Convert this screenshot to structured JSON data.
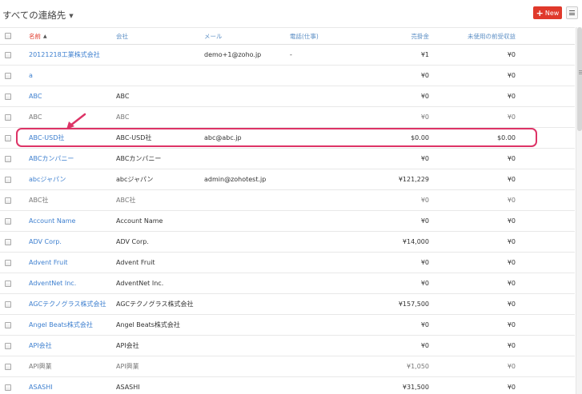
{
  "header": {
    "view_title": "すべての連絡先",
    "new_button_label": "New"
  },
  "columns": {
    "name": "名前",
    "company": "会社",
    "email": "メール",
    "phone": "電話(仕事)",
    "sales": "売掛金",
    "unused": "未使用の前受収益"
  },
  "rows": [
    {
      "name": "20121218工業株式会社",
      "company": "",
      "email": "demo+1@zoho.jp",
      "phone": "-",
      "sales": "¥1",
      "unused": "¥0"
    },
    {
      "name": "a",
      "company": "",
      "email": "",
      "phone": "",
      "sales": "¥0",
      "unused": "¥0"
    },
    {
      "name": "ABC",
      "company": "ABC",
      "email": "",
      "phone": "",
      "sales": "¥0",
      "unused": "¥0"
    },
    {
      "name": "ABC",
      "company": "ABC",
      "email": "",
      "phone": "",
      "sales": "¥0",
      "unused": "¥0"
    },
    {
      "name": "ABC-USD社",
      "company": "ABC-USD社",
      "email": "abc@abc.jp",
      "phone": "",
      "sales": "$0.00",
      "unused": "$0.00"
    },
    {
      "name": "ABCカンパニー",
      "company": "ABCカンパニー",
      "email": "",
      "phone": "",
      "sales": "¥0",
      "unused": "¥0"
    },
    {
      "name": "abcジャパン",
      "company": "abcジャパン",
      "email": "admin@zohotest.jp",
      "phone": "",
      "sales": "¥121,229",
      "unused": "¥0"
    },
    {
      "name": "ABC社",
      "company": "ABC社",
      "email": "",
      "phone": "",
      "sales": "¥0",
      "unused": "¥0"
    },
    {
      "name": "Account Name",
      "company": "Account Name",
      "email": "",
      "phone": "",
      "sales": "¥0",
      "unused": "¥0"
    },
    {
      "name": "ADV Corp.",
      "company": "ADV Corp.",
      "email": "",
      "phone": "",
      "sales": "¥14,000",
      "unused": "¥0"
    },
    {
      "name": "Advent Fruit",
      "company": "Advent Fruit",
      "email": "",
      "phone": "",
      "sales": "¥0",
      "unused": "¥0"
    },
    {
      "name": "AdventNet Inc.",
      "company": "AdventNet Inc.",
      "email": "",
      "phone": "",
      "sales": "¥0",
      "unused": "¥0"
    },
    {
      "name": "AGCテクノグラス株式会社",
      "company": "AGCテクノグラス株式会社",
      "email": "",
      "phone": "",
      "sales": "¥157,500",
      "unused": "¥0"
    },
    {
      "name": "Angel Beats株式会社",
      "company": "Angel Beats株式会社",
      "email": "",
      "phone": "",
      "sales": "¥0",
      "unused": "¥0"
    },
    {
      "name": "API会社",
      "company": "API会社",
      "email": "",
      "phone": "",
      "sales": "¥0",
      "unused": "¥0"
    },
    {
      "name": "API興業",
      "company": "API興業",
      "email": "",
      "phone": "",
      "sales": "¥1,050",
      "unused": "¥0"
    },
    {
      "name": "ASASHI",
      "company": "ASASHI",
      "email": "",
      "phone": "",
      "sales": "¥31,500",
      "unused": "¥0"
    }
  ],
  "styles": {
    "link_color": "#3d7fcf",
    "accent_red": "#e0392b",
    "highlight_color": "#dd3366"
  }
}
